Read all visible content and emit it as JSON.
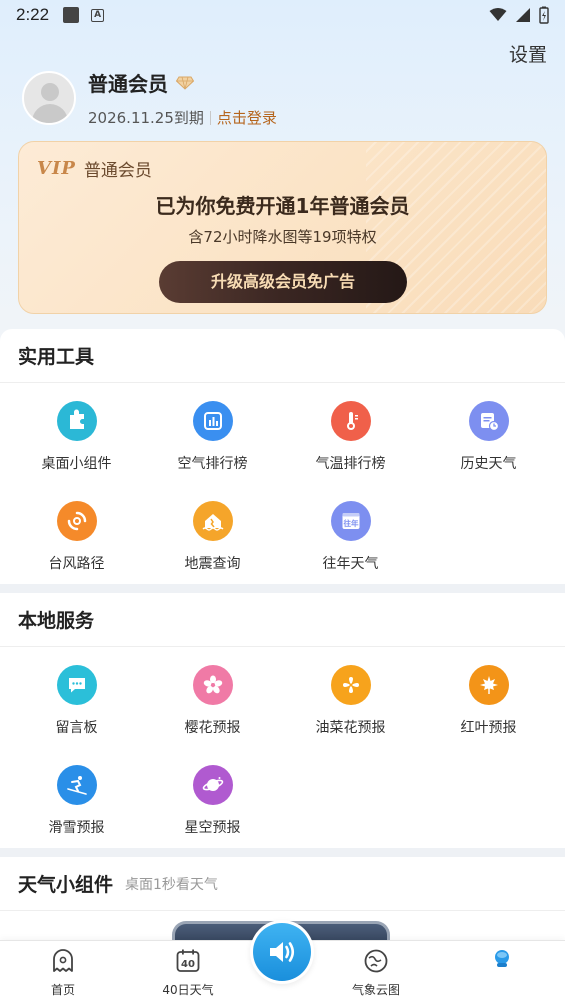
{
  "status_bar": {
    "time": "2:22",
    "a_label": "A"
  },
  "header": {
    "settings_label": "设置"
  },
  "profile": {
    "member_name": "普通会员",
    "expire_date": "2026.11.25到期",
    "login_label": "点击登录"
  },
  "vip_card": {
    "logo": "VIP",
    "level": "普通会员",
    "title": "已为你免费开通1年普通会员",
    "subtitle": "含72小时降水图等19项特权",
    "button_label": "升级高级会员免广告"
  },
  "tools": {
    "title": "实用工具",
    "items": [
      {
        "label": "桌面小组件",
        "icon": "puzzle-icon",
        "color": "#2bb8d6"
      },
      {
        "label": "空气排行榜",
        "icon": "bar-chart-icon",
        "color": "#3a8ff0"
      },
      {
        "label": "气温排行榜",
        "icon": "thermometer-icon",
        "color": "#f0604a"
      },
      {
        "label": "历史天气",
        "icon": "calendar-clock-icon",
        "color": "#7d8ff0"
      },
      {
        "label": "台风路径",
        "icon": "typhoon-icon",
        "color": "#f58a2a"
      },
      {
        "label": "地震查询",
        "icon": "earthquake-icon",
        "color": "#f5a52a"
      },
      {
        "label": "往年天气",
        "icon": "past-years-icon",
        "color": "#7d8ff0",
        "badge": "往年"
      }
    ]
  },
  "local": {
    "title": "本地服务",
    "items": [
      {
        "label": "留言板",
        "icon": "message-icon",
        "color": "#2bbfd9"
      },
      {
        "label": "樱花预报",
        "icon": "sakura-icon",
        "color": "#f07aa6"
      },
      {
        "label": "油菜花预报",
        "icon": "rapeseed-flower-icon",
        "color": "#f7a31c"
      },
      {
        "label": "红叶预报",
        "icon": "red-leaf-icon",
        "color": "#f39418"
      },
      {
        "label": "滑雪预报",
        "icon": "skiing-icon",
        "color": "#2a8fe8"
      },
      {
        "label": "星空预报",
        "icon": "planet-icon",
        "color": "#b05ad0"
      }
    ]
  },
  "widget_section": {
    "title": "天气小组件",
    "subtitle": "桌面1秒看天气"
  },
  "bottom_nav": {
    "items": [
      {
        "label": "首页",
        "icon": "home-ghost-icon"
      },
      {
        "label": "40日天气",
        "icon": "calendar-40-icon",
        "badge": "40"
      },
      {
        "label": "",
        "icon": "speaker-icon"
      },
      {
        "label": "气象云图",
        "icon": "cloud-map-icon"
      },
      {
        "label": "",
        "icon": "profile-icon"
      }
    ]
  },
  "colors": {
    "accent": "#1a8fdc",
    "vip_gold": "#c8874a",
    "login_link": "#b5651d"
  }
}
